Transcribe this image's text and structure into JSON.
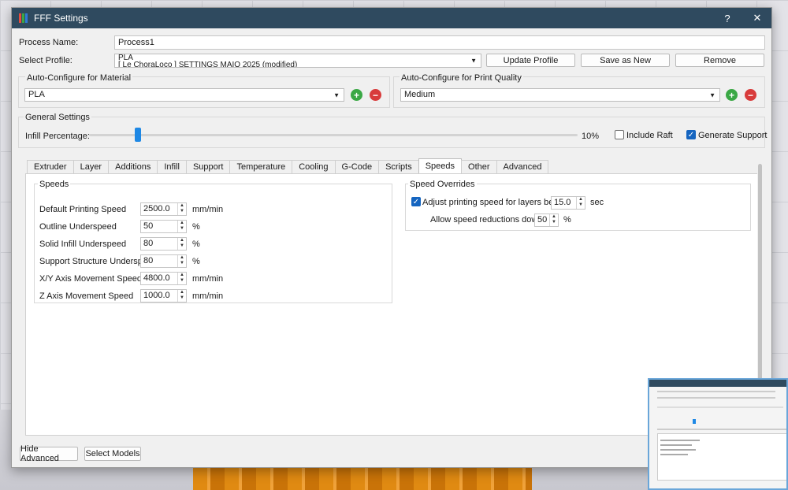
{
  "window": {
    "title": "FFF Settings",
    "help_label": "?",
    "close_label": "✕"
  },
  "colors": {
    "titlebar": "#2f4a5f",
    "accent": "#1565c0",
    "add": "#3aa845",
    "remove": "#d83b3b",
    "slider": "#1e88e5"
  },
  "process": {
    "label": "Process Name:",
    "value": "Process1"
  },
  "profile": {
    "label": "Select Profile:",
    "value_line1": "PLA",
    "value_line2": "[ Le ChoraLoco ] SETTINGS MAIO 2025 (modified)",
    "update_label": "Update Profile",
    "save_label": "Save as New",
    "remove_label": "Remove"
  },
  "material": {
    "title": "Auto-Configure for Material",
    "value": "PLA",
    "add_icon": "plus-circle-icon",
    "remove_icon": "minus-circle-icon"
  },
  "quality": {
    "title": "Auto-Configure for Print Quality",
    "value": "Medium"
  },
  "general": {
    "title": "General Settings",
    "infill_label": "Infill Percentage:",
    "infill_value": "10%",
    "infill_fraction": 0.1,
    "raft_label": "Include Raft",
    "raft_checked": false,
    "support_label": "Generate Support",
    "support_checked": true
  },
  "tabs": [
    "Extruder",
    "Layer",
    "Additions",
    "Infill",
    "Support",
    "Temperature",
    "Cooling",
    "G-Code",
    "Scripts",
    "Speeds",
    "Other",
    "Advanced"
  ],
  "active_tab": "Speeds",
  "speeds": {
    "title": "Speeds",
    "rows": [
      {
        "label": "Default Printing Speed",
        "value": "2500.0",
        "unit": "mm/min"
      },
      {
        "label": "Outline Underspeed",
        "value": "50",
        "unit": "%"
      },
      {
        "label": "Solid Infill Underspeed",
        "value": "80",
        "unit": "%"
      },
      {
        "label": "Support Structure Underspeed",
        "value": "80",
        "unit": "%"
      },
      {
        "label": "X/Y Axis Movement Speed",
        "value": "4800.0",
        "unit": "mm/min"
      },
      {
        "label": "Z Axis Movement Speed",
        "value": "1000.0",
        "unit": "mm/min"
      }
    ]
  },
  "overrides": {
    "title": "Speed Overrides",
    "adjust_label": "Adjust printing speed for layers below",
    "adjust_checked": true,
    "adjust_value": "15.0",
    "adjust_unit": "sec",
    "reduction_label": "Allow speed reductions down to",
    "reduction_value": "50",
    "reduction_unit": "%"
  },
  "footer": {
    "hide_advanced": "Hide Advanced",
    "select_models": "Select Models"
  }
}
